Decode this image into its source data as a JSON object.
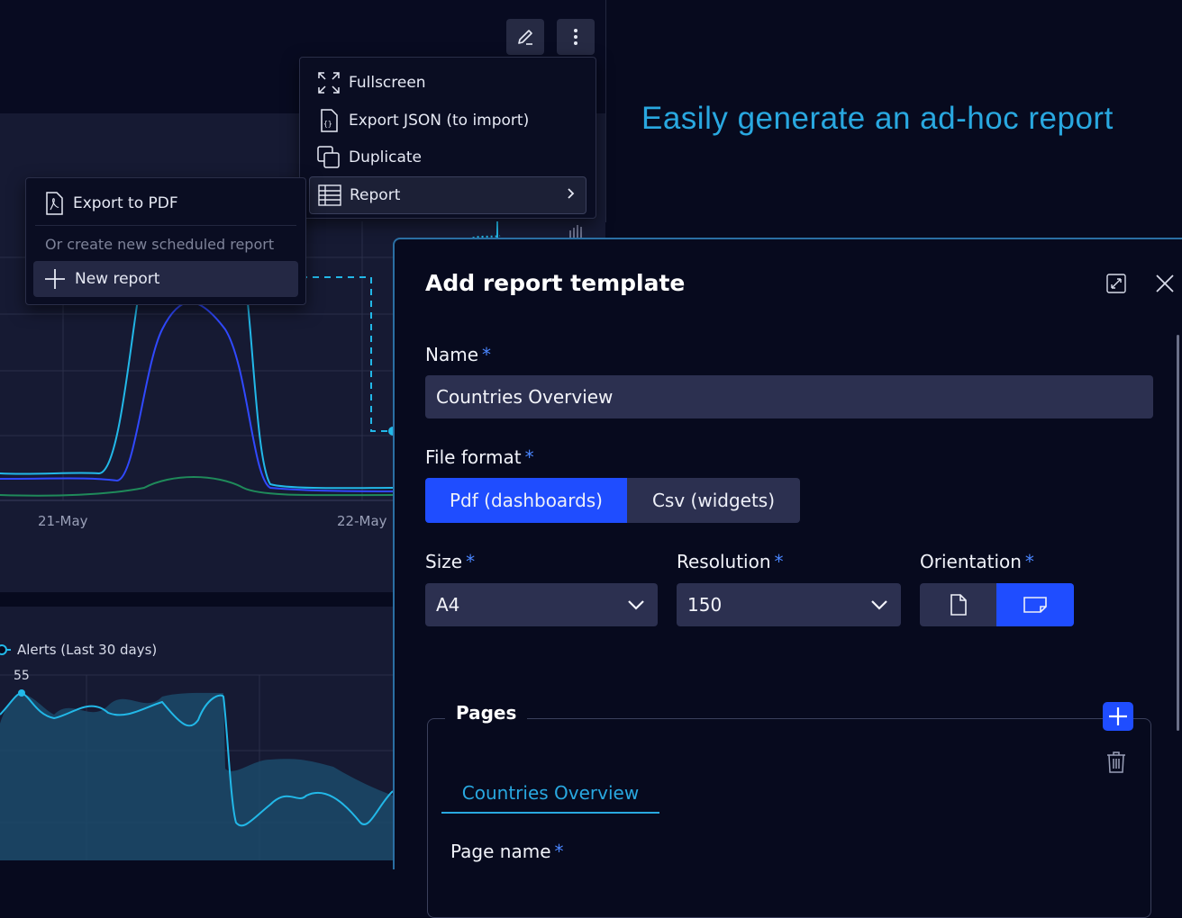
{
  "tagline": "Easily generate an ad-hoc report",
  "toolbar": {
    "edit_icon": "pencil-icon",
    "more_icon": "kebab-icon"
  },
  "main_menu": {
    "items": [
      {
        "label": "Fullscreen",
        "icon": "fullscreen-icon"
      },
      {
        "label": "Export JSON (to import)",
        "icon": "json-file-icon"
      },
      {
        "label": "Duplicate",
        "icon": "duplicate-icon"
      },
      {
        "label": "Report",
        "icon": "table-icon",
        "submenu": "chevron-right-icon"
      }
    ]
  },
  "report_submenu": {
    "export_pdf": "Export to PDF",
    "hint": "Or create new scheduled report",
    "new_report": "New report"
  },
  "chart1": {
    "x_labels": [
      "21-May",
      "22-May"
    ]
  },
  "chart2": {
    "legend": "Alerts (Last 30 days)",
    "peak_label": "55"
  },
  "dialog": {
    "title": "Add report template",
    "name_label": "Name",
    "name_value": "Countries Overview",
    "file_format_label": "File format",
    "file_format_options": [
      "Pdf (dashboards)",
      "Csv (widgets)"
    ],
    "file_format_selected": "Pdf (dashboards)",
    "size_label": "Size",
    "size_value": "A4",
    "resolution_label": "Resolution",
    "resolution_value": "150",
    "orientation_label": "Orientation",
    "orientation_selected": "landscape",
    "required_mark": "*",
    "pages_label": "Pages",
    "page_tab": "Countries Overview",
    "page_name_label": "Page name"
  },
  "colors": {
    "accent": "#1f4dff",
    "tagline": "#29a8e0",
    "link": "#29a8e0",
    "required": "#4a86ff"
  }
}
